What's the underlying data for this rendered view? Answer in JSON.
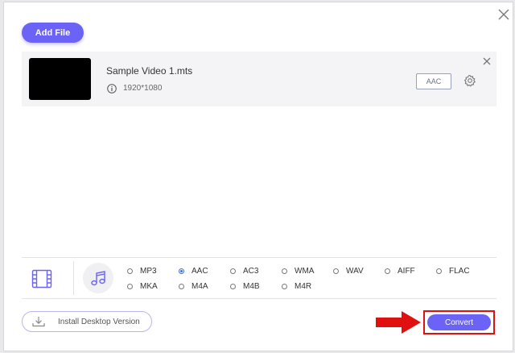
{
  "toolbar": {
    "add_file_label": "Add File"
  },
  "file": {
    "name": "Sample Video 1.mts",
    "resolution": "1920*1080",
    "output_format": "AAC"
  },
  "formats": {
    "selected": "AAC",
    "audio_options": [
      "MP3",
      "AAC",
      "AC3",
      "WMA",
      "WAV",
      "AIFF",
      "FLAC",
      "MKA",
      "M4A",
      "M4B",
      "M4R"
    ]
  },
  "footer": {
    "install_label": "Install Desktop Version",
    "convert_label": "Convert"
  },
  "colors": {
    "accent": "#6b62f6",
    "highlight": "#e01010"
  }
}
